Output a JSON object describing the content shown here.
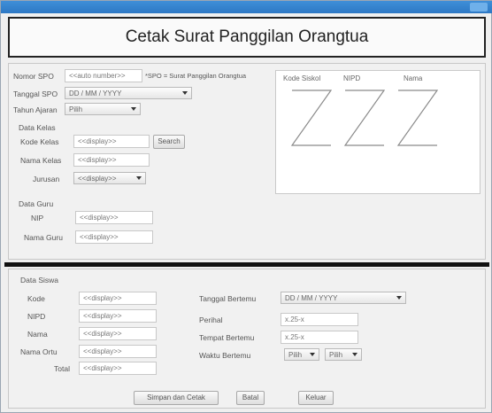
{
  "window": {
    "title": ""
  },
  "header": {
    "title": "Cetak Surat Panggilan Orangtua"
  },
  "top": {
    "nomor_spo_label": "Nomor SPO",
    "nomor_spo_value": "<<auto number>>",
    "spo_note": "*SPO = Surat Panggilan Orangtua",
    "tanggal_spo_label": "Tanggal SPO",
    "tanggal_spo_value": "DD / MM / YYYY",
    "tahun_ajaran_label": "Tahun Ajaran",
    "tahun_ajaran_value": "Pilih",
    "data_kelas_label": "Data Kelas",
    "kode_kelas_label": "Kode Kelas",
    "kode_kelas_value": "<<display>>",
    "search_label": "Search",
    "nama_kelas_label": "Nama Kelas",
    "nama_kelas_value": "<<display>>",
    "jurusan_label": "Jurusan",
    "jurusan_value": "<<display>>",
    "data_guru_label": "Data Guru",
    "nip_label": "NIP",
    "nip_value": "<<display>>",
    "nama_guru_label": "Nama Guru",
    "nama_guru_value": "<<display>>"
  },
  "table": {
    "columns": [
      "Kode Siskol",
      "NIPD",
      "Nama"
    ]
  },
  "bottom": {
    "data_siswa_label": "Data Siswa",
    "kode_label": "Kode",
    "kode_value": "<<display>>",
    "nipd_label": "NIPD",
    "nipd_value": "<<display>>",
    "nama_label": "Nama",
    "nama_value": "<<display>>",
    "nama_ortu_label": "Nama Ortu",
    "nama_ortu_value": "<<display>>",
    "total_label": "Total",
    "total_value": "<<display>>",
    "tanggal_bertemu_label": "Tanggal Bertemu",
    "tanggal_bertemu_value": "DD / MM / YYYY",
    "perihal_label": "Perihal",
    "perihal_value": "x.25-x",
    "tempat_bertemu_label": "Tempat Bertemu",
    "tempat_bertemu_value": "x.25-x",
    "waktu_bertemu_label": "Waktu Bertemu",
    "waktu_jam_value": "Pilih",
    "waktu_menit_value": "Pilih"
  },
  "buttons": {
    "simpan_cetak": "Simpan dan Cetak",
    "batal": "Batal",
    "keluar": "Keluar"
  }
}
